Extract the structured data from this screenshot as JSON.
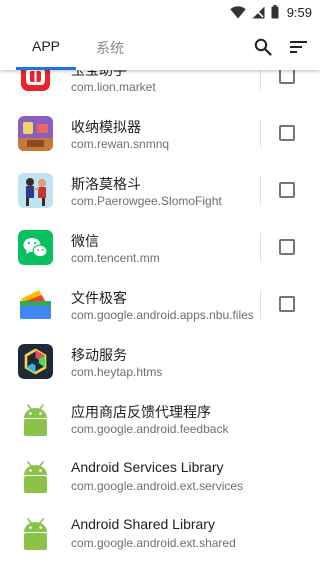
{
  "status_bar": {
    "time": "9:59"
  },
  "toolbar": {
    "tabs": [
      {
        "label": "APP",
        "active": true
      },
      {
        "label": "系统",
        "active": false
      }
    ],
    "accent": "#1a73e8"
  },
  "apps": [
    {
      "name": "玉宝助手",
      "package": "com.lion.market",
      "icon": "lion-market-icon",
      "has_checkbox": true
    },
    {
      "name": "收纳模拟器",
      "package": "com.rewan.snmnq",
      "icon": "storage-game-icon",
      "has_checkbox": true
    },
    {
      "name": "斯洛莫格斗",
      "package": "com.Paerowgee.SlomoFight",
      "icon": "slomo-fight-icon",
      "has_checkbox": true
    },
    {
      "name": "微信",
      "package": "com.tencent.mm",
      "icon": "wechat-icon",
      "has_checkbox": true
    },
    {
      "name": "文件极客",
      "package": "com.google.android.apps.nbu.files",
      "icon": "files-icon",
      "has_checkbox": true
    },
    {
      "name": "移动服务",
      "package": "com.heytap.htms",
      "icon": "heytap-services-icon",
      "has_checkbox": false
    },
    {
      "name": "应用商店反馈代理程序",
      "package": "com.google.android.feedback",
      "icon": "android-robot-icon",
      "has_checkbox": false
    },
    {
      "name": "Android Services Library",
      "package": "com.google.android.ext.services",
      "icon": "android-robot-icon",
      "has_checkbox": false
    },
    {
      "name": "Android Shared Library",
      "package": "com.google.android.ext.shared",
      "icon": "android-robot-icon",
      "has_checkbox": false
    }
  ]
}
